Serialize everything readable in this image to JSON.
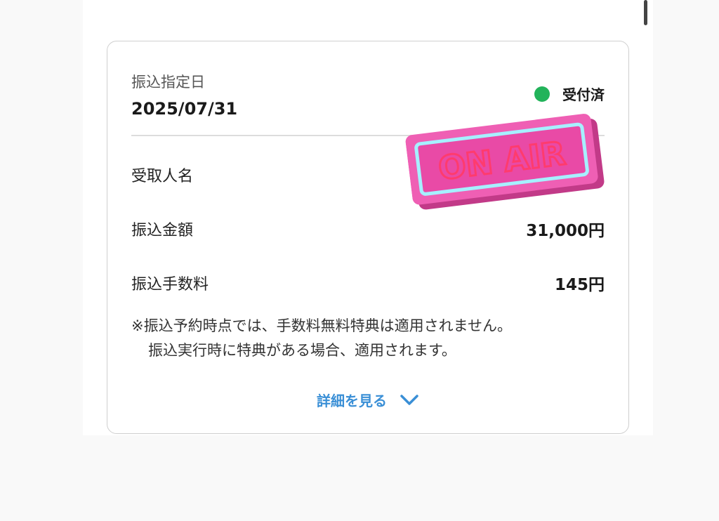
{
  "transfer": {
    "date_label": "振込指定日",
    "date_value": "2025/07/31",
    "status_label": "受付済",
    "recipient_label": "受取人名",
    "amount_label": "振込金額",
    "amount_value": "31,000円",
    "fee_label": "振込手数料",
    "fee_value": "145円",
    "note_line1": "※振込予約時点では、手数料無料特典は適用されません。",
    "note_line2": "振込実行時に特典がある場合、適用されます。",
    "details_label": "詳細を見る"
  },
  "sticker": {
    "text": "ON AIR"
  },
  "colors": {
    "status_dot": "#22b35a",
    "link": "#3a8fd6",
    "sticker_pink": "#e94aa6",
    "neon_outline": "#a6f0ff"
  },
  "icons": {
    "status": "status-dot-icon",
    "expand": "chevron-down-icon"
  }
}
